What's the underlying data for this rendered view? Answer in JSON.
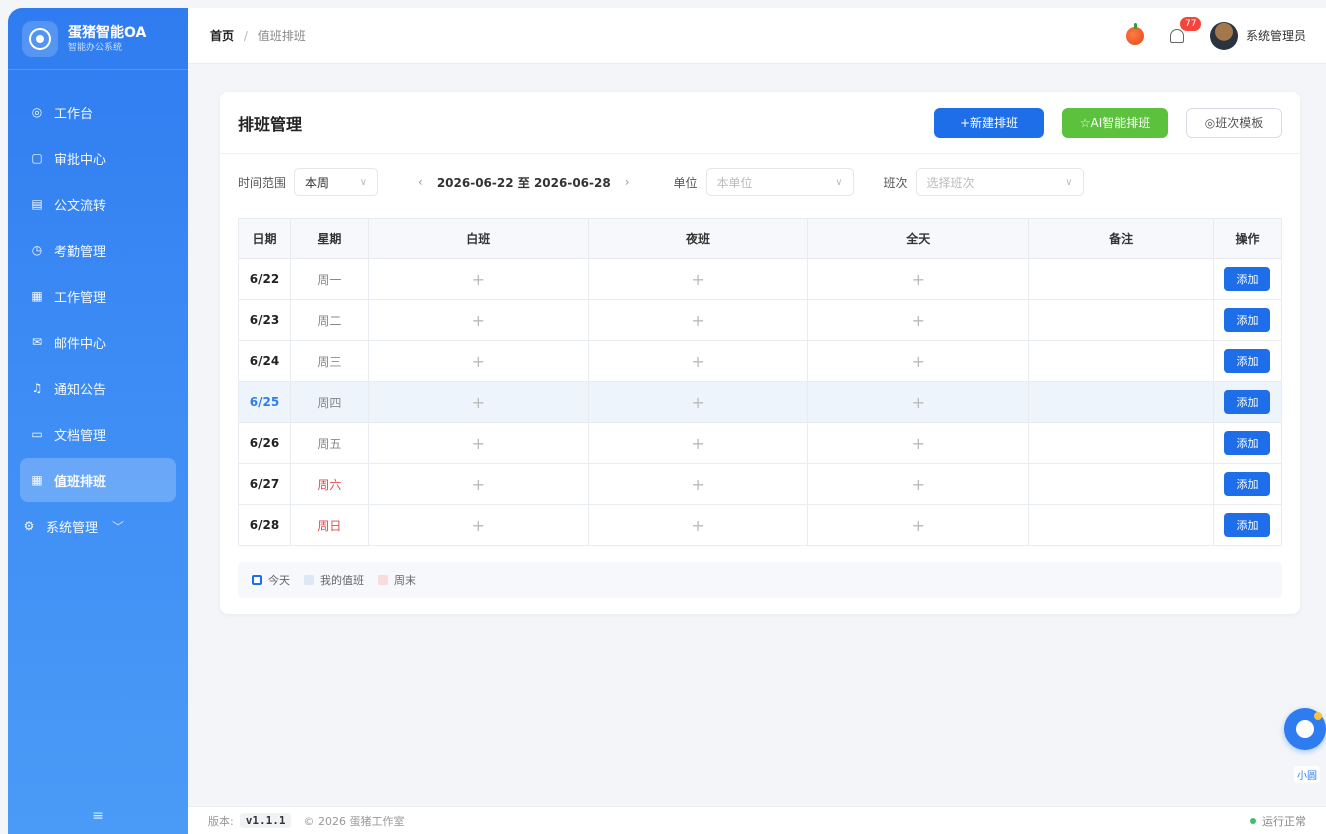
{
  "brand": {
    "title": "蛋猪智能OA",
    "subtitle": "智能办公系统"
  },
  "sidebar": {
    "items": [
      {
        "label": "工作台",
        "icon": "dashboard-icon"
      },
      {
        "label": "审批中心",
        "icon": "approval-icon"
      },
      {
        "label": "公文流转",
        "icon": "document-icon"
      },
      {
        "label": "考勤管理",
        "icon": "clock-icon"
      },
      {
        "label": "工作管理",
        "icon": "calendar-icon"
      },
      {
        "label": "邮件中心",
        "icon": "mail-icon"
      },
      {
        "label": "通知公告",
        "icon": "bell-icon"
      },
      {
        "label": "文档管理",
        "icon": "folder-icon"
      },
      {
        "label": "值班排班",
        "icon": "calendar-icon",
        "active": true
      },
      {
        "label": "系统管理",
        "icon": "gear-icon",
        "expandable": true
      }
    ],
    "footer_icon": "menu-icon"
  },
  "header": {
    "breadcrumb_home": "首页",
    "breadcrumb_sep": "/",
    "breadcrumb_current": "值班排班",
    "notifications": "77",
    "user_name": "系统管理员"
  },
  "page": {
    "title": "排班管理",
    "btn_new": "+新建排班",
    "btn_ai": "☆AI智能排班",
    "btn_template": "◎班次模板"
  },
  "filters": {
    "time_label": "时间范围",
    "time_value": "本周",
    "range": "2026-06-22 至 2026-06-28",
    "unit_label": "单位",
    "unit_placeholder": "本单位",
    "shift_label": "班次",
    "shift_placeholder": "选择班次"
  },
  "table": {
    "headers": [
      "日期",
      "星期",
      "白班",
      "夜班",
      "全天",
      "备注",
      "操作"
    ],
    "add_label": "添加",
    "plus": "+",
    "rows": [
      {
        "date": "6/22",
        "week": "周一"
      },
      {
        "date": "6/23",
        "week": "周二"
      },
      {
        "date": "6/24",
        "week": "周三"
      },
      {
        "date": "6/25",
        "week": "周四",
        "today": true
      },
      {
        "date": "6/26",
        "week": "周五"
      },
      {
        "date": "6/27",
        "week": "周六",
        "weekend": true
      },
      {
        "date": "6/28",
        "week": "周日",
        "weekend": true
      }
    ]
  },
  "legend": {
    "today": "今天",
    "mine": "我的值班",
    "weekend": "周末"
  },
  "footer": {
    "version_label": "版本:",
    "version": "v1.1.1",
    "copyright": "© 2026 蛋猪工作室",
    "status": "运行正常"
  },
  "assistant": {
    "label": "小圆"
  },
  "colors": {
    "primary": "#1d6ee8",
    "ai": "#5cc13c",
    "weekend": "#e34a4a",
    "sidebar": "#2f7cf0"
  }
}
